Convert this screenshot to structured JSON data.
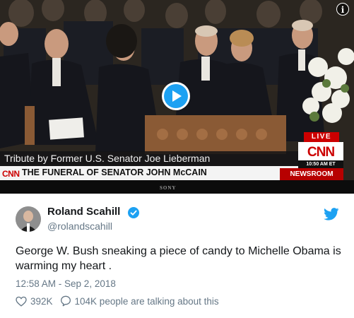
{
  "video": {
    "info_symbol": "i",
    "lower_third": "Tribute by Former U.S. Senator Joe Lieberman",
    "network_small": "CNN",
    "headline": "THE FUNERAL OF SENATOR JOHN McCAIN",
    "live_label": "LIVE",
    "network_logo": "CNN",
    "time": "10:50 AM ET",
    "newsroom": "NEWSROOM",
    "tv_brand": "SONY",
    "play_icon": "play-icon"
  },
  "tweet": {
    "author_name": "Roland Scahill",
    "handle": "@rolandscahill",
    "text": "George W. Bush sneaking a piece of candy to Michelle Obama is warming my heart .",
    "timestamp": "12:58 AM - Sep 2, 2018",
    "likes": "392K",
    "talking": "104K people are talking about this"
  },
  "colors": {
    "twitter_blue": "#1da1f2",
    "cnn_red": "#cc0000",
    "text_primary": "#14171a",
    "text_secondary": "#657786"
  }
}
